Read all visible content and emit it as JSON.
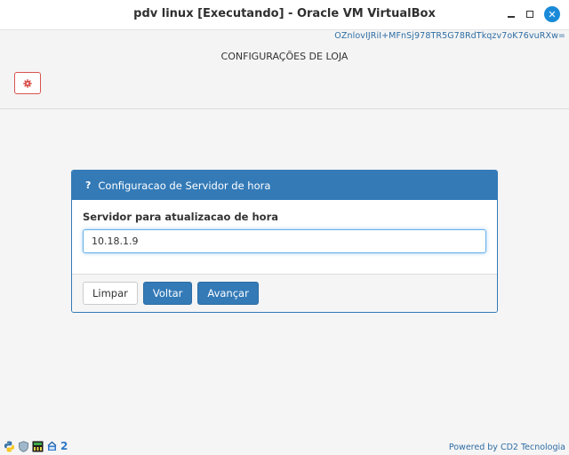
{
  "window": {
    "title": "pdv linux [Executando] - Oracle VM VirtualBox",
    "close_glyph": "✕"
  },
  "header": {
    "token": "OZnlovIJRiI+MFnSj978TR5G78RdTkqzv7oK76vuRXw=",
    "title": "CONFIGURAÇÕES DE LOJA",
    "settings_icon": "gear-icon"
  },
  "panel": {
    "icon_glyph": "?",
    "title": "Configuracao de Servidor de hora",
    "field_label": "Servidor para atualizacao de hora",
    "field_value": "10.18.1.9",
    "buttons": {
      "clear": "Limpar",
      "back": "Voltar",
      "next": "Avançar"
    }
  },
  "tray": {
    "icons": [
      "python-icon",
      "shield-icon",
      "network-card-icon",
      "monitor-icon",
      "number-two-icon"
    ],
    "two_label": "2"
  },
  "footer": {
    "powered_by": "Powered by CD2 Tecnologia"
  },
  "colors": {
    "primary": "#337ab7",
    "danger": "#d9534f",
    "close_button": "#1a8ad8"
  }
}
